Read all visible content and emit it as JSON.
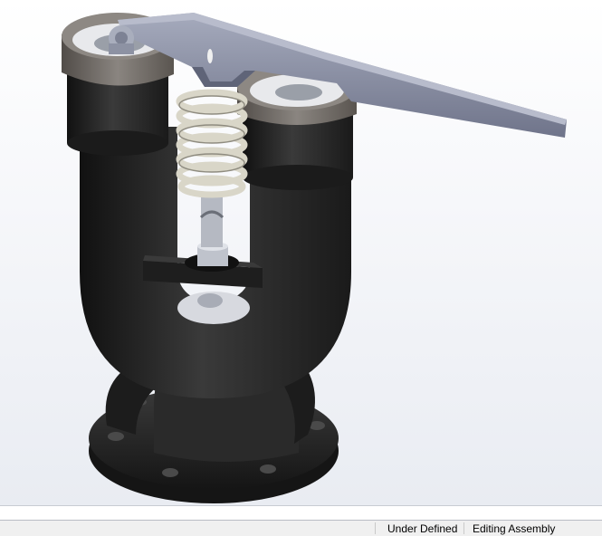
{
  "statusbar": {
    "definition_state": "Under Defined",
    "edit_mode": "Editing Assembly"
  },
  "graphics_area": {
    "model": "valve-with-lever-assembly",
    "background": [
      "#ffffff",
      "#e9ecf2"
    ]
  },
  "colors": {
    "casting": "#2a2a2a",
    "caps": "#6e6a66",
    "lever": "#8e93a6",
    "spring": "#d9d6c8"
  }
}
